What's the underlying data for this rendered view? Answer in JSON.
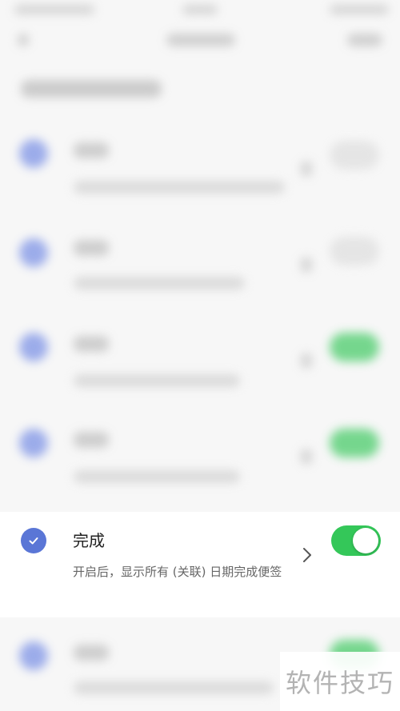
{
  "focused_setting": {
    "title": "完成",
    "description": "开启后，显示所有 (关联) 日期完成便签",
    "enabled": true,
    "check_icon": "check-icon",
    "chevron_icon": "chevron-right-icon"
  },
  "colors": {
    "accent": "#5a76d6",
    "toggle_on": "#34c759",
    "text_primary": "#222222",
    "text_secondary": "#666666"
  },
  "watermark": {
    "text": "软件技巧"
  }
}
